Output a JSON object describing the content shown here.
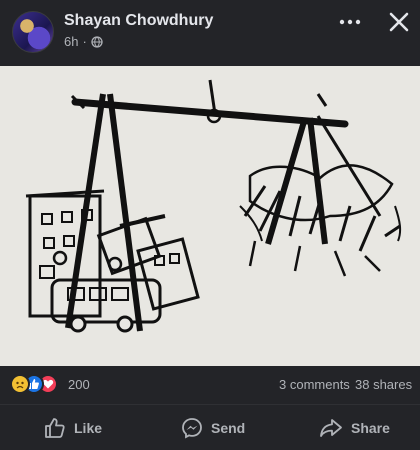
{
  "post": {
    "author": "Shayan Chowdhury",
    "time": "6h",
    "separator": "·",
    "privacy_icon": "globe-icon",
    "menu_icon": "more-options-icon",
    "close_icon": "close-icon"
  },
  "photo": {
    "description_icon": "hand-drawn-scale-image"
  },
  "stats": {
    "reaction_icons": [
      "sad-reaction-icon",
      "like-reaction-icon",
      "love-reaction-icon"
    ],
    "reaction_count": "200",
    "comments": "3 comments",
    "shares": "38 shares"
  },
  "actions": {
    "like": "Like",
    "send": "Send",
    "share": "Share"
  },
  "colors": {
    "background": "#232428",
    "text": "#e4e6eb",
    "muted": "#b0b3b8",
    "like_blue": "#1b74e4",
    "love_red": "#f33e58",
    "sad_yellow": "#f2c033"
  }
}
